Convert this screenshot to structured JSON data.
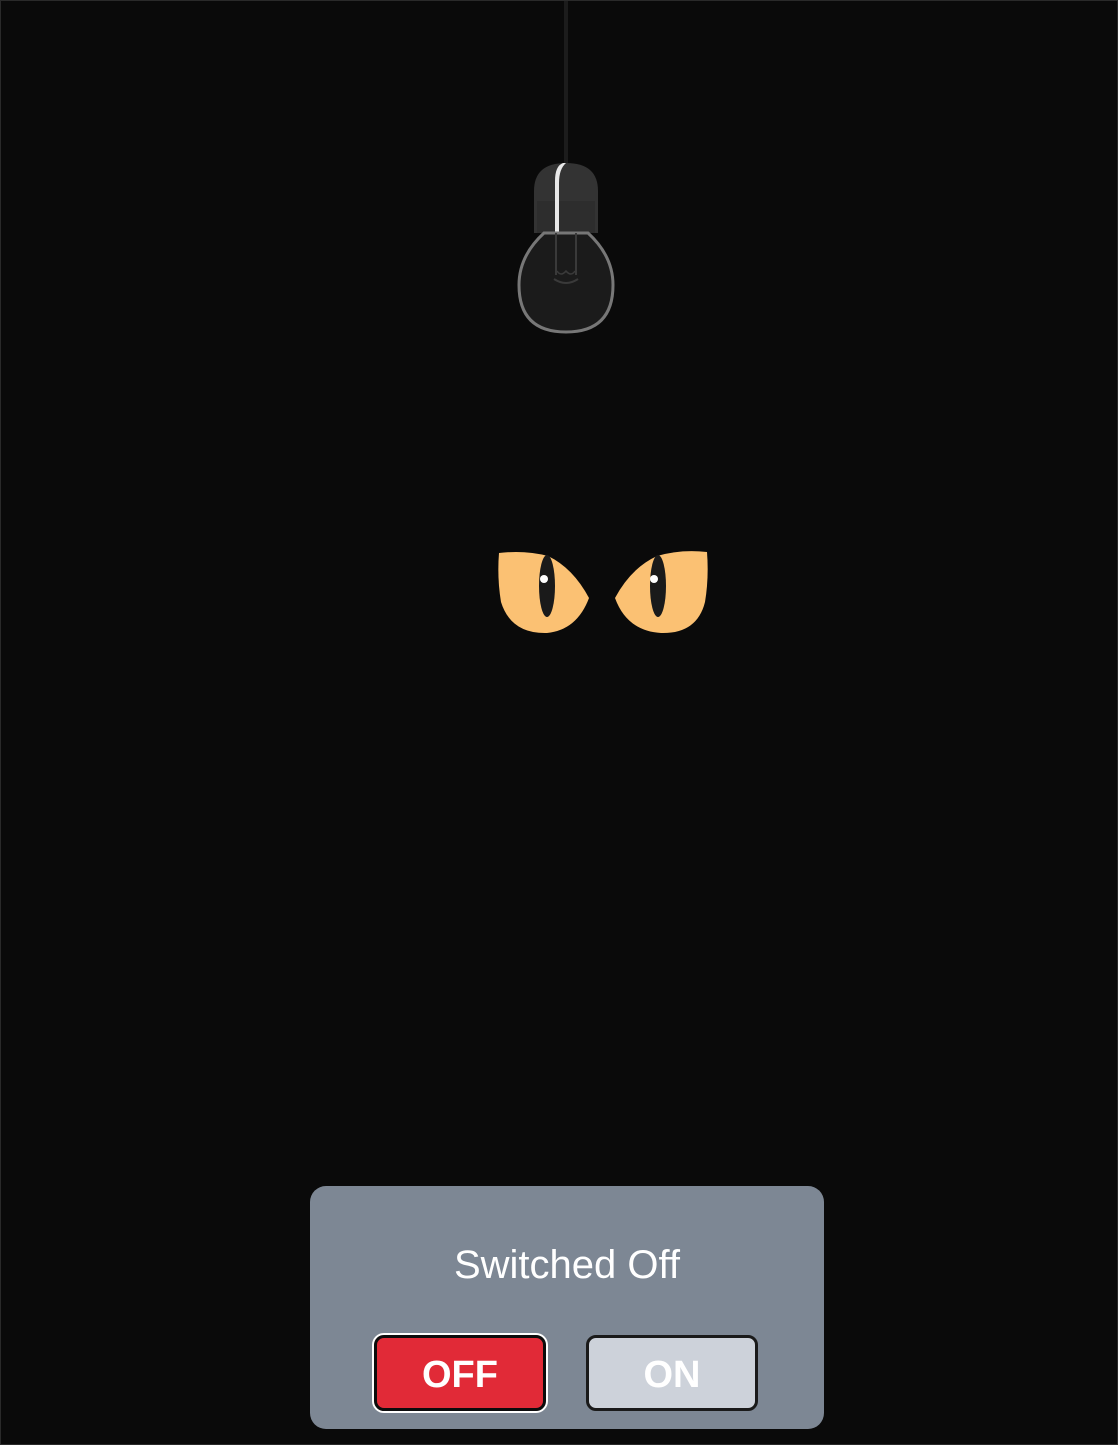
{
  "status": {
    "text": "Switched Off"
  },
  "controls": {
    "off_label": "OFF",
    "on_label": "ON",
    "active": "off"
  },
  "colors": {
    "background": "#0a0a0a",
    "panel": "#7d8794",
    "off_button": "#e12a37",
    "on_button": "#cdd2da",
    "eye_iris": "#fbc173"
  },
  "icons": {
    "bulb": "light-bulb-icon",
    "eyes": "cat-eyes-icon"
  }
}
